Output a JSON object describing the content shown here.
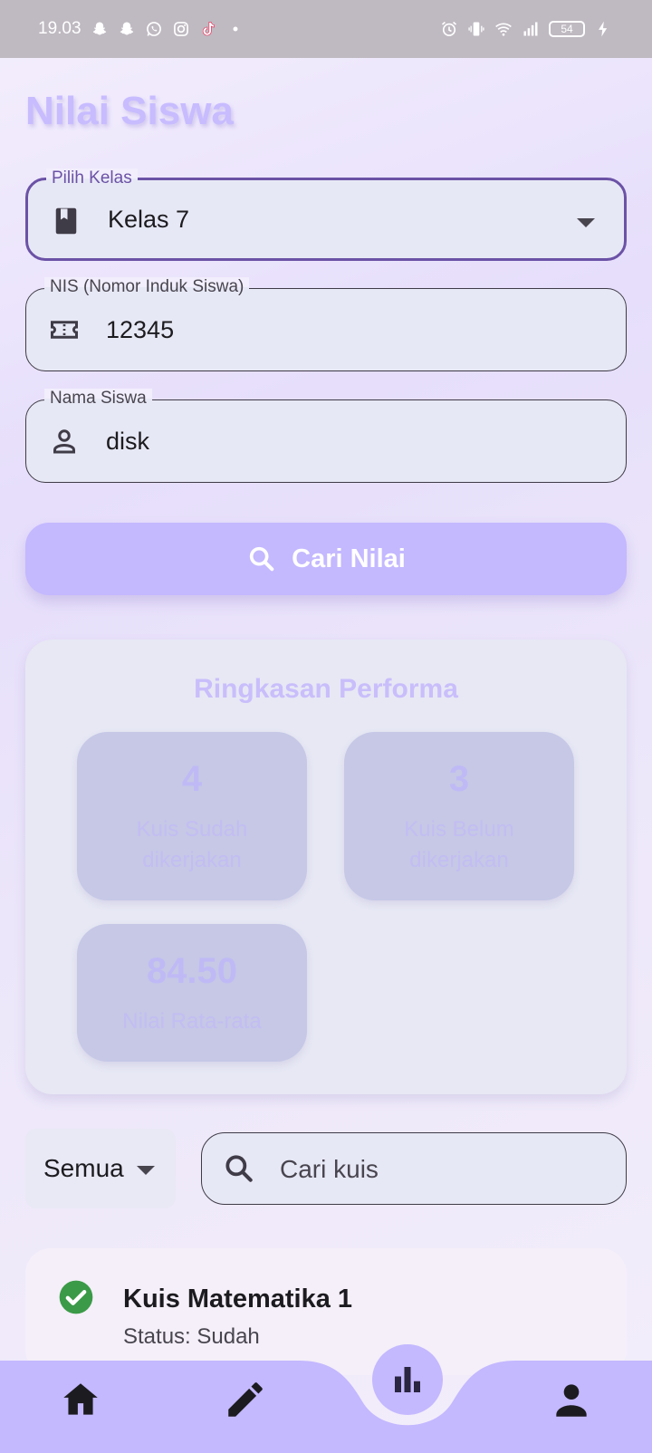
{
  "status_bar": {
    "time": "19.03",
    "battery": "54",
    "left_icons": [
      "snapchat-icon",
      "snapchat-icon",
      "whatsapp-icon",
      "instagram-icon",
      "tiktok-icon",
      "dot-icon"
    ],
    "right_icons": [
      "alarm-icon",
      "vibrate-icon",
      "wifi-icon",
      "signal-icon",
      "battery-icon",
      "charging-icon"
    ]
  },
  "page": {
    "title": "Nilai Siswa"
  },
  "form": {
    "class_select": {
      "label": "Pilih Kelas",
      "value": "Kelas 7",
      "icon": "book-icon"
    },
    "nis": {
      "label": "NIS (Nomor Induk Siswa)",
      "value": "12345",
      "icon": "ticket-icon"
    },
    "name": {
      "label": "Nama Siswa",
      "value": "disk",
      "icon": "person-icon"
    },
    "search_button": {
      "label": "Cari Nilai",
      "icon": "search-icon"
    }
  },
  "summary": {
    "title": "Ringkasan Performa",
    "stats": [
      {
        "value": "4",
        "label_line1": "Kuis Sudah",
        "label_line2": "dikerjakan"
      },
      {
        "value": "3",
        "label_line1": "Kuis Belum",
        "label_line2": "dikerjakan"
      },
      {
        "value": "84.50",
        "label_line1": "Nilai Rata-rata"
      }
    ]
  },
  "filter": {
    "selected": "Semua",
    "search_placeholder": "Cari kuis"
  },
  "quizzes": [
    {
      "title": "Kuis Matematika 1",
      "status": "Status: Sudah"
    }
  ],
  "bottom_nav": {
    "items": [
      "home-icon",
      "edit-icon",
      "bar-chart-icon",
      "profile-icon"
    ],
    "active": "bar-chart-icon"
  },
  "colors": {
    "accent": "#c4b8ff",
    "focus_border": "#6b52a6",
    "success": "#3b9a48"
  }
}
